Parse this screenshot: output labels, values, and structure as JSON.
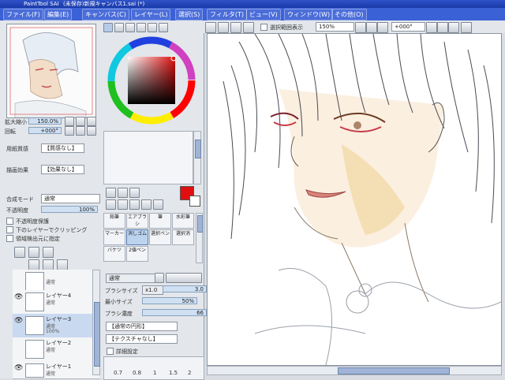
{
  "window": {
    "app_name": "PaintTool SAI",
    "file_name": "(未保存)新規キャンバス1.sai (*)"
  },
  "menu": [
    {
      "label": "ファイル(F)"
    },
    {
      "label": "編集(E)"
    },
    {
      "label": "キャンバス(C)"
    },
    {
      "label": "レイヤー(L)"
    },
    {
      "label": "選択(S)"
    },
    {
      "label": "フィルタ(T)"
    },
    {
      "label": "ビュー(V)"
    },
    {
      "label": "ウィンドウ(W)"
    },
    {
      "label": "その他(O)"
    }
  ],
  "navigator": {
    "zoom_label": "拡大縮小",
    "zoom_value": "150.0%",
    "rotate_label": "回転",
    "rotate_value": "+000°"
  },
  "layer_props": {
    "paper_texture_label": "用紙質感",
    "paper_texture_value": "【質感なし】",
    "paper_effect_label": "描画効果",
    "paper_effect_value": "【効果なし】",
    "blend_mode_label": "合成モード",
    "blend_mode_value": "通常",
    "opacity_label": "不透明度",
    "opacity_value": "100%",
    "checkboxes": [
      {
        "label": "不透明度保護"
      },
      {
        "label": "下のレイヤーでクリッピング"
      },
      {
        "label": "領域検出元に指定"
      }
    ]
  },
  "layers": [
    {
      "name": "",
      "mode": "通常",
      "opacity": "",
      "selected": false
    },
    {
      "name": "レイヤー4",
      "mode": "通常",
      "opacity": "",
      "selected": false
    },
    {
      "name": "レイヤー3",
      "mode": "通常",
      "opacity": "100%",
      "selected": true
    },
    {
      "name": "レイヤー2",
      "mode": "通常",
      "opacity": "",
      "selected": false
    },
    {
      "name": "レイヤー1",
      "mode": "通常",
      "opacity": "",
      "selected": false
    }
  ],
  "color": {
    "primary": "#e01010",
    "ring_accent": "#d040c0"
  },
  "tools": {
    "row1": [
      "鉛筆",
      "エアブラシ",
      "筆",
      "水彩筆"
    ],
    "row2": [
      "マーカー",
      "消しゴム",
      "選択ペン",
      "選択消"
    ],
    "row3": [
      "バケツ",
      "2値ペン",
      "",
      ""
    ]
  },
  "brush": {
    "normal_label": "通常",
    "size_label": "ブラシサイズ",
    "size_mult": "x1.0",
    "size_value": "3.0",
    "min_size_label": "最小サイズ",
    "min_size_value": "50%",
    "density_label": "ブラシ濃度",
    "density_value": "66",
    "shape_value": "【通常の円形】",
    "texture_value": "【テクスチャなし】",
    "detail_label": "詳細設定",
    "size_presets": [
      "0.7",
      "0.8",
      "1",
      "1.5",
      "2"
    ]
  },
  "canvas_toolbar": {
    "selection_label": "選択範囲表示",
    "zoom_value": "150%",
    "rotation_value": "+000°"
  }
}
